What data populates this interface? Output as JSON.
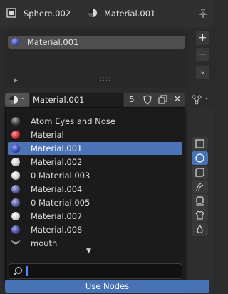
{
  "header": {
    "object_name": "Sphere.002",
    "material_name": "Material.001",
    "object_icon": "sphere-object-icon",
    "material_icon": "material-icon",
    "pin_icon": "pin-icon"
  },
  "slots": {
    "items": [
      {
        "label": "Material.001",
        "color": "#3b4aa6"
      }
    ]
  },
  "slot_buttons": {
    "add": "+",
    "remove": "−"
  },
  "id_selector": {
    "value": "Material.001",
    "users": "5"
  },
  "material_list": {
    "items": [
      {
        "label": "Atom Eyes and Nose",
        "color": "#555555",
        "selected": false
      },
      {
        "label": "Material",
        "color": "#c8333a",
        "selected": false
      },
      {
        "label": "Material.001",
        "color": "#3b4aa6",
        "selected": true
      },
      {
        "label": "Material.002",
        "color": "#d0d0d0",
        "selected": false
      },
      {
        "label": "0 Material.003",
        "color": "#d0d0d0",
        "selected": false
      },
      {
        "label": "Material.004",
        "color": "#5a5f9a",
        "selected": false
      },
      {
        "label": "0 Material.005",
        "color": "#5a5f9a",
        "selected": false
      },
      {
        "label": "Material.007",
        "color": "#d0d0d0",
        "selected": false
      },
      {
        "label": "Material.008",
        "color": "#4a4f9a",
        "selected": false
      },
      {
        "label": "mouth",
        "color": "#888888",
        "selected": false
      }
    ],
    "search_placeholder": ""
  },
  "use_nodes_label": "Use Nodes",
  "colors": {
    "accent": "#4772b3",
    "selection": "#4d72b5"
  }
}
